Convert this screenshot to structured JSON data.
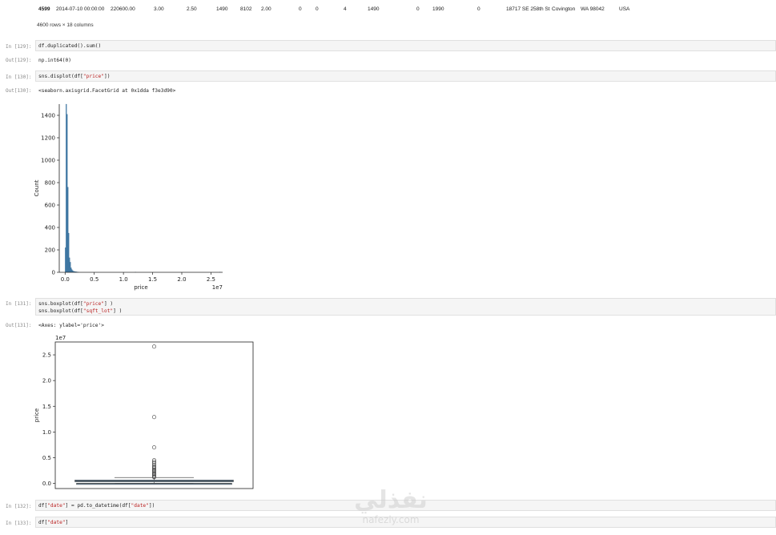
{
  "dataframe": {
    "last_row": [
      "4599",
      "2014-07-10 00:00:00",
      "220600.00",
      "3.00",
      "2.50",
      "1490",
      "8102",
      "2.00",
      "0",
      "0",
      "4",
      "1490",
      "0",
      "1990",
      "0",
      "18717 SE 258th St",
      "Covington",
      "WA 98042",
      "USA"
    ],
    "shape_text": "4600 rows × 18 columns"
  },
  "cells": [
    {
      "in_prompt": "In [129]:",
      "code": [
        "df.duplicated().sum()"
      ],
      "out_prompt": "Out[129]:",
      "output": "np.int64(0)"
    },
    {
      "in_prompt": "In [130]:",
      "code_parts": [
        "sns.displot(df[",
        "\"price\"",
        "])"
      ],
      "out_prompt": "Out[130]:",
      "output": "<seaborn.axisgrid.FacetGrid at 0x1dda f3e3d90>"
    },
    {
      "in_prompt": "In [131]:",
      "code_lines": [
        [
          "sns.boxplot(df[",
          "\"price\"",
          "] )"
        ],
        [
          "sns.boxplot(df[",
          "\"sqft_lot\"",
          "] )"
        ]
      ],
      "out_prompt": "Out[131]:",
      "output": "<Axes: ylabel='price'>"
    },
    {
      "in_prompt": "In [132]:",
      "code_parts": [
        "df[",
        "\"date\"",
        "] = pd.to_datetime(df[",
        "\"date\"",
        "])"
      ]
    },
    {
      "in_prompt": "In [133]:",
      "code_parts": [
        "df[",
        "\"date\"",
        "]"
      ]
    }
  ],
  "watermark": {
    "arabic": "نفذلي",
    "latin": "nafezly.com"
  },
  "colors": {
    "bar": "#3a78a8",
    "box": "#3f6f95",
    "cell_bg": "#f5f5f5"
  },
  "chart_data": [
    {
      "type": "bar",
      "title": "",
      "xlabel": "price",
      "ylabel": "Count",
      "x_offset_label": "1e7",
      "x_ticks": [
        "0.0",
        "0.5",
        "1.0",
        "1.5",
        "2.0",
        "2.5"
      ],
      "y_ticks": [
        "0",
        "200",
        "400",
        "600",
        "800",
        "1000",
        "1200",
        "1400"
      ],
      "xlim": [
        -0.1,
        2.7
      ],
      "ylim": [
        0,
        1500
      ],
      "bin_width": 0.0138,
      "x": [
        0.0,
        0.0138,
        0.0276,
        0.0414,
        0.0552,
        0.069,
        0.0828,
        0.0966,
        0.1104,
        0.1242,
        0.138,
        0.1518,
        0.1656,
        0.1794,
        0.1932,
        0.207,
        0.2208,
        1.2,
        2.65
      ],
      "values": [
        220,
        1500,
        1410,
        760,
        350,
        130,
        90,
        40,
        25,
        15,
        10,
        8,
        6,
        5,
        4,
        3,
        2,
        1,
        1
      ]
    },
    {
      "type": "box",
      "title": "",
      "ylabel": "price",
      "y_offset_label": "1e7",
      "y_ticks": [
        "0.0",
        "0.5",
        "1.0",
        "1.5",
        "2.0",
        "2.5"
      ],
      "ylim": [
        -0.1,
        2.75
      ],
      "series": [
        {
          "name": "price",
          "q1": 0.032,
          "median": 0.046,
          "q3": 0.065,
          "whisker_low": 0.0,
          "whisker_high": 0.114,
          "outliers": [
            2.66,
            1.29,
            0.7,
            0.45,
            0.42,
            0.39,
            0.36,
            0.33,
            0.31,
            0.29,
            0.27,
            0.25,
            0.23,
            0.21,
            0.19,
            0.17,
            0.15,
            0.13,
            0.12
          ]
        },
        {
          "name": "sqft_lot",
          "q1": 0.0005,
          "median": 0.00076,
          "q3": 0.0011,
          "whisker_low": 0.0,
          "whisker_high": 0.002,
          "outliers": []
        }
      ]
    }
  ]
}
